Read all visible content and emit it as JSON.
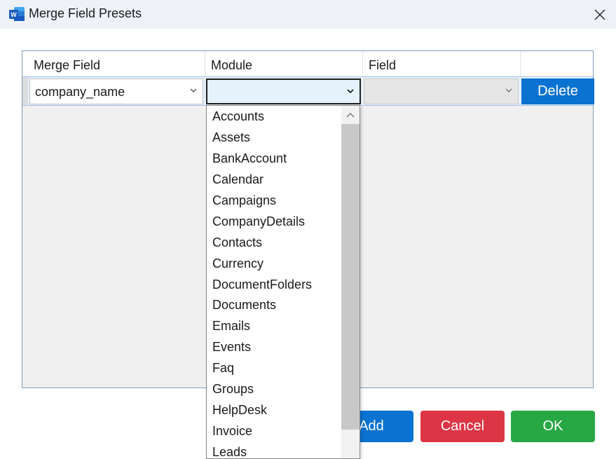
{
  "window": {
    "title": "Merge Field Presets",
    "icon": "word-app-icon",
    "close_icon": "close-icon"
  },
  "grid": {
    "columns": [
      "Merge Field",
      "Module",
      "Field"
    ],
    "rows": [
      {
        "merge_field": "company_name",
        "module": "",
        "field": "",
        "delete_label": "Delete"
      }
    ]
  },
  "module_dropdown": {
    "options": [
      "Accounts",
      "Assets",
      "BankAccount",
      "Calendar",
      "Campaigns",
      "CompanyDetails",
      "Contacts",
      "Currency",
      "DocumentFolders",
      "Documents",
      "Emails",
      "Events",
      "Faq",
      "Groups",
      "HelpDesk",
      "Invoice",
      "Leads"
    ]
  },
  "buttons": {
    "add": "Add",
    "cancel": "Cancel",
    "ok": "OK"
  },
  "colors": {
    "primary": "#0a72d0",
    "danger": "#dc3545",
    "success": "#28a745"
  }
}
